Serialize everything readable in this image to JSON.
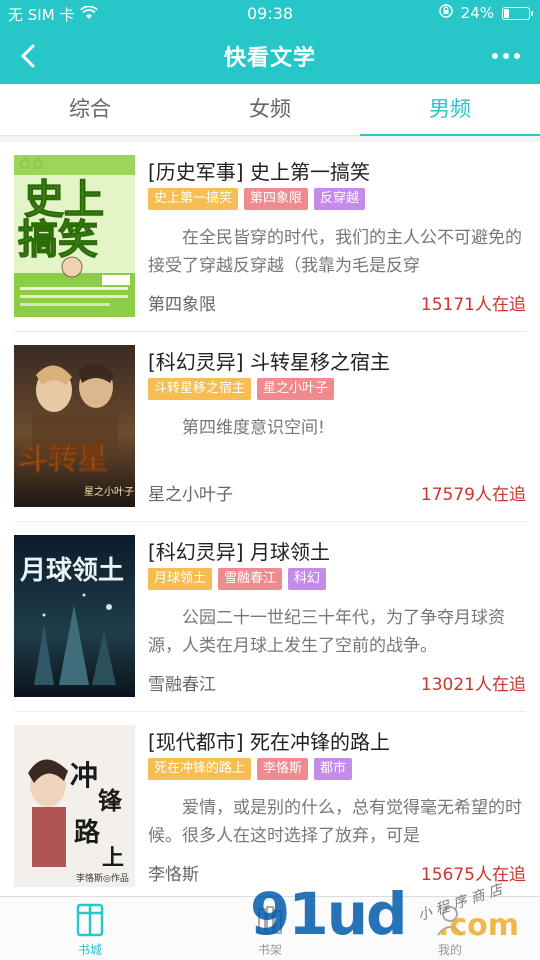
{
  "status_bar": {
    "carrier": "无 SIM 卡",
    "wifi_icon": "wifi-icon",
    "time": "09:38",
    "lock_icon": "orientation-lock-icon",
    "battery_text": "24%",
    "battery_level": 0.24
  },
  "navbar": {
    "title": "快看文学",
    "back_icon": "chevron-left-icon",
    "more_icon": "more-dots-icon"
  },
  "tabs": [
    {
      "label": "综合",
      "active": false
    },
    {
      "label": "女频",
      "active": false
    },
    {
      "label": "男频",
      "active": true
    }
  ],
  "books": [
    {
      "title": "[历史军事] 史上第一搞笑",
      "tags": [
        "史上第一搞笑",
        "第四象限",
        "反穿越"
      ],
      "desc": "在全民皆穿的时代，我们的主人公不可避免的接受了穿越反穿越（我靠为毛是反穿",
      "author": "第四象限",
      "followers": "15171人在追",
      "cover_colors": [
        "#8ed04b",
        "#dff2bd"
      ]
    },
    {
      "title": "[科幻灵异] 斗转星移之宿主",
      "tags": [
        "斗转星移之宿主",
        "星之小叶子"
      ],
      "desc": "第四维度意识空间!",
      "author": "星之小叶子",
      "followers": "17579人在追",
      "cover_colors": [
        "#2b1f1a",
        "#c98b2f"
      ]
    },
    {
      "title": "[科幻灵异] 月球领土",
      "tags": [
        "月球领土",
        "雪融春江",
        "科幻"
      ],
      "desc": "公园二十一世纪三十年代，为了争夺月球资源，人类在月球上发生了空前的战争。",
      "author": "雪融春江",
      "followers": "13021人在追",
      "cover_colors": [
        "#0f1f2e",
        "#3f6f7a"
      ]
    },
    {
      "title": "[现代都市] 死在冲锋的路上",
      "tags": [
        "死在冲锋的路上",
        "李恪斯",
        "都市"
      ],
      "desc": "爱情，或是别的什么，总有觉得毫无希望的时候。很多人在这时选择了放弃，可是",
      "author": "李恪斯",
      "followers": "15675人在追",
      "cover_colors": [
        "#f4f1ec",
        "#d9d2c7"
      ]
    }
  ],
  "tabbar": {
    "items": [
      {
        "label": "书城",
        "icon": "bookstore-icon",
        "active": true
      },
      {
        "label": "书架",
        "icon": "bookshelf-icon",
        "active": false
      },
      {
        "label": "我的",
        "icon": "profile-icon",
        "active": false
      }
    ]
  },
  "watermark": {
    "big": "91ud",
    "com": ".com",
    "small": "小 程 序 商 店"
  },
  "colors": {
    "accent": "#27c6c9",
    "followers": "#c9352d",
    "tag_yellow": "#f5bd52",
    "tag_red": "#f08a8e",
    "tag_purple": "#c58be8"
  }
}
